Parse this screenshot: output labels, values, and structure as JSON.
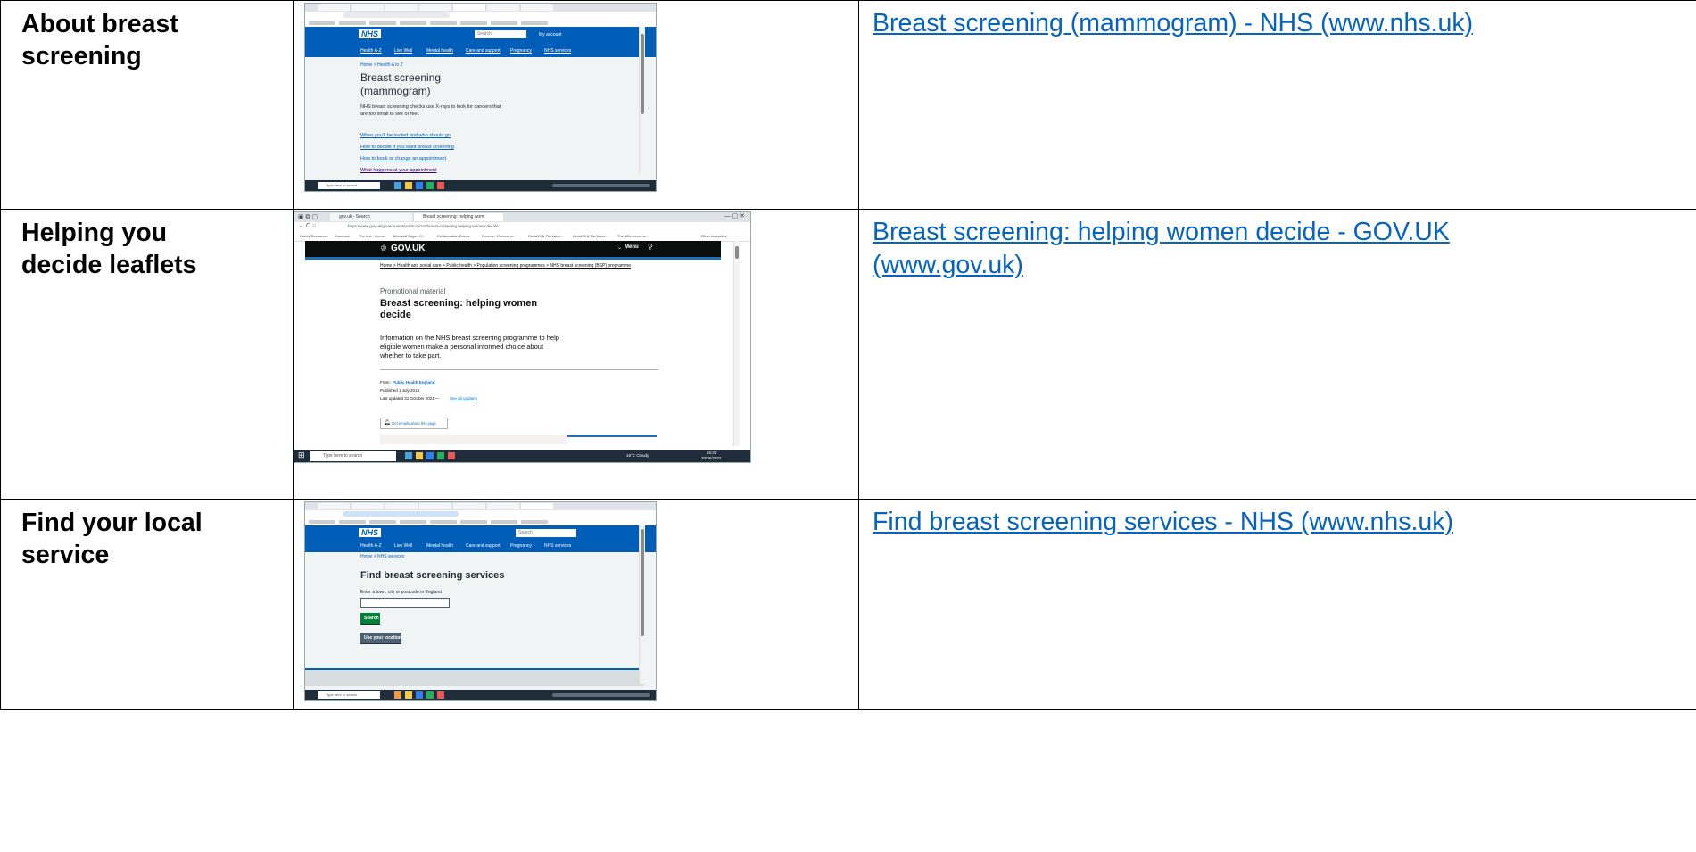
{
  "rows": [
    {
      "label": "About breast screening",
      "link": "Breast screening (mammogram) - NHS (www.nhs.uk)",
      "screenshot": {
        "site": "NHS",
        "search_placeholder": "Search",
        "account": "My account",
        "nav": [
          "Health A-Z",
          "Live Well",
          "Mental health",
          "Care and support",
          "Pregnancy",
          "NHS services"
        ],
        "breadcrumb": "Home  >  Health A to Z",
        "heading_line1": "Breast screening",
        "heading_line2": "(mammogram)",
        "intro_line1": "NHS breast screening checks use X-rays to look for cancers that",
        "intro_line2": "are too small to see or feel.",
        "links": [
          "When you'll be invited and who should go",
          "How to decide if you want breast screening",
          "How to book or change an appointment",
          "What happens at your appointment"
        ],
        "taskbar_search": "Type here to search"
      }
    },
    {
      "label": "Helping you decide leaflets",
      "link": "Breast screening: helping women decide - GOV.UK (www.gov.uk)",
      "screenshot": {
        "tab1": "gov.uk - Search",
        "tab2": "Breast screening: helping wom",
        "url": "https://www.gov.uk/government/publications/breast-screening-helping-women-decide",
        "bookmarks": [
          "Useful Resources",
          "Hancock",
          "The hub - Home",
          "Microsoft Edge - C...",
          "Collaboration Drives",
          "Forums - Comms w...",
          "Covid19 & Flu Vacci...",
          "Covid19 & Flu Vacci...",
          "The differences w...",
          "Other favourites"
        ],
        "site": "GOV.UK",
        "menu": "Menu",
        "breadcrumb": "Home  >  Health and social care  >  Public health  >  Population screening programmes  >  NHS breast screening (BSP) programme",
        "caption": "Promotional material",
        "heading_line1": "Breast screening: helping women",
        "heading_line2": "decide",
        "summary_line1": "Information on the NHS breast screening programme to help",
        "summary_line2": "eligible women make a personal informed choice about",
        "summary_line3": "whether to take part.",
        "from_label": "From:",
        "from_org": "Public Health England",
        "published": "Published 1 July 2013",
        "updated": "Last updated 31 October 2021 —",
        "see_updates": "See all updates",
        "emails": "Get emails about this page",
        "taskbar_search": "Type here to search",
        "weather": "16°C Cloudy",
        "time": "15:32",
        "date": "20/06/2022"
      }
    },
    {
      "label": "Find your local service",
      "link": "Find breast screening services - NHS (www.nhs.uk)",
      "screenshot": {
        "site": "NHS",
        "search_placeholder": "Search",
        "nav": [
          "Health A-Z",
          "Live Well",
          "Mental health",
          "Care and support",
          "Pregnancy",
          "NHS services"
        ],
        "breadcrumb": "Home  >  NHS services",
        "heading": "Find breast screening services",
        "field_label": "Enter a town, city or postcode in England",
        "search_button": "Search",
        "location_button": "Use your location",
        "taskbar_search": "Type here to search"
      }
    }
  ],
  "colors": {
    "nhs_blue": "#005eb8",
    "link": "#0563c1",
    "govuk_black": "#0b0c0c",
    "nhs_green": "#007f3b"
  }
}
